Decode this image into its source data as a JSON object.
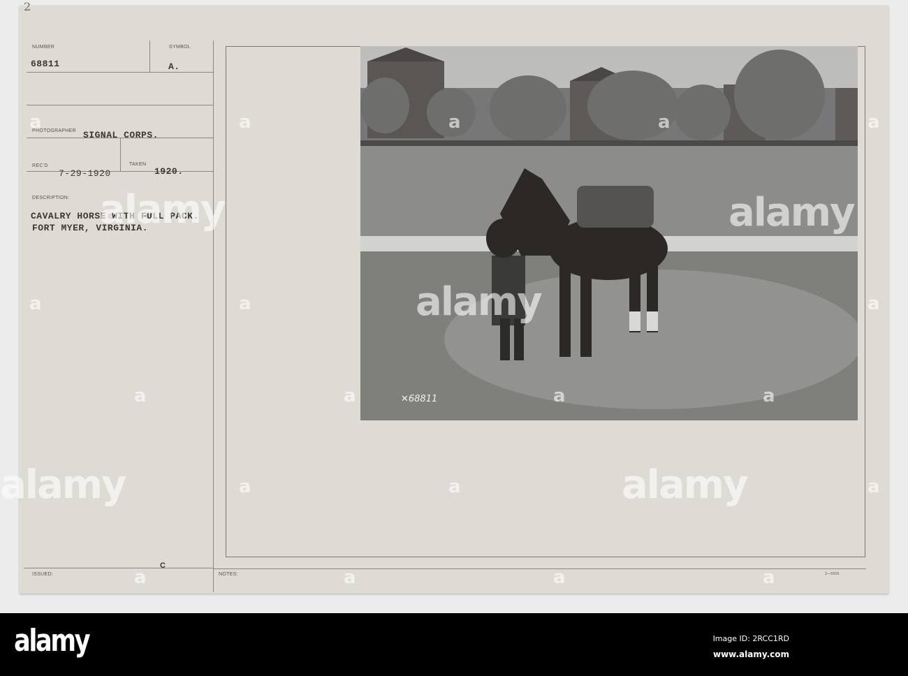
{
  "card": {
    "corner_mark": "2",
    "number_label": "NUMBER",
    "number_value": "68811",
    "symbol_label": "SYMBOL",
    "symbol_value": "A.",
    "photographer_label": "PHOTOGRAPHER",
    "photographer_value": "SIGNAL CORPS.",
    "recd_label": "REC'D",
    "recd_value": "7-29-1920",
    "taken_label": "TAKEN",
    "taken_value": "1920.",
    "description_label": "DESCRIPTION:",
    "description_line1": "CAVALRY HORSE WITH FULL PACK.",
    "description_line2": "FORT MYER, VIRGINIA.",
    "issued_label": "ISSUED:",
    "issued_mark": "C",
    "notes_label": "NOTES:",
    "form_number": "3—5505"
  },
  "photo": {
    "caption": "✕68811"
  },
  "watermark": {
    "text": "alamy",
    "letter": "a"
  },
  "footer": {
    "logo": "alamy",
    "image_id": "Image ID: 2RCC1RD",
    "url": "www.alamy.com"
  }
}
